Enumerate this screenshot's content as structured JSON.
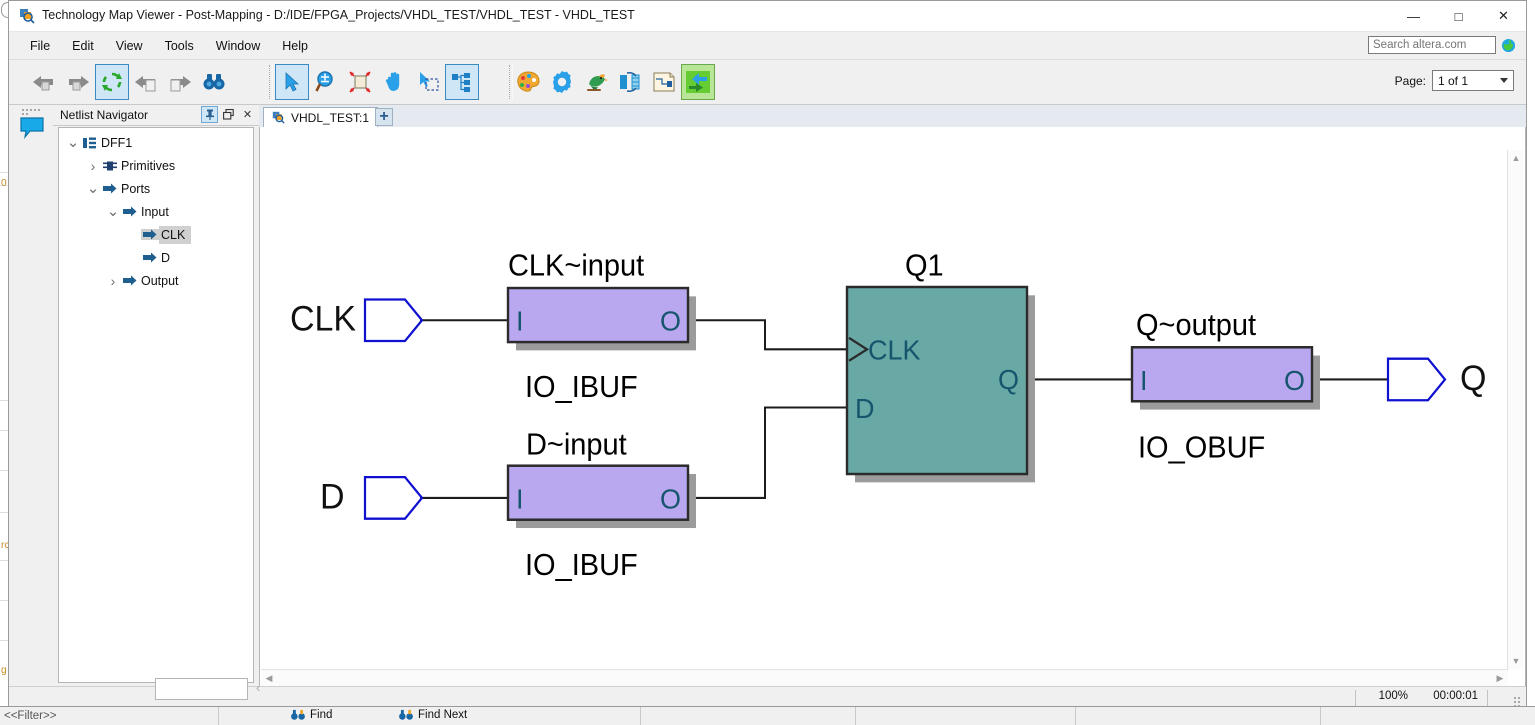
{
  "window": {
    "title": "Technology Map Viewer - Post-Mapping - D:/IDE/FPGA_Projects/VHDL_TEST/VHDL_TEST - VHDL_TEST",
    "app_icon": "technology-map-viewer-icon",
    "minimize": "—",
    "maximize": "□",
    "close": "✕"
  },
  "menu": {
    "items": [
      {
        "label": "File",
        "mnemonic": "F"
      },
      {
        "label": "Edit",
        "mnemonic": "E"
      },
      {
        "label": "View",
        "mnemonic": "V"
      },
      {
        "label": "Tools",
        "mnemonic": "T"
      },
      {
        "label": "Window",
        "mnemonic": "W"
      },
      {
        "label": "Help",
        "mnemonic": "H"
      }
    ],
    "search_placeholder": "Search altera.com",
    "search_value": "",
    "globe_icon": "globe-icon"
  },
  "toolbar": {
    "group1": [
      {
        "name": "back-icon",
        "enabled": false
      },
      {
        "name": "forward-icon",
        "enabled": false
      },
      {
        "name": "refresh-icon",
        "enabled": true,
        "active": true
      },
      {
        "name": "previous-page-icon",
        "enabled": false
      },
      {
        "name": "next-page-icon",
        "enabled": false
      },
      {
        "name": "find-binoculars-icon",
        "enabled": true
      }
    ],
    "group2": [
      {
        "name": "select-pointer-icon",
        "active": true
      },
      {
        "name": "zoom-tool-icon",
        "active": false
      },
      {
        "name": "fit-in-window-icon",
        "active": false
      },
      {
        "name": "hand-pan-icon",
        "active": false
      },
      {
        "name": "rubber-band-select-icon",
        "active": false
      },
      {
        "name": "hierarchy-tree-icon",
        "active": true
      }
    ],
    "group3": [
      {
        "name": "color-palette-icon",
        "active": false
      },
      {
        "name": "settings-gear-icon",
        "active": false
      },
      {
        "name": "bird-chip-planner-icon",
        "active": false
      },
      {
        "name": "rotate-object-icon",
        "active": false
      },
      {
        "name": "schematic-doc-icon",
        "active": false
      },
      {
        "name": "inputs-outputs-icon",
        "active": true
      }
    ],
    "page_label": "Page:",
    "page_value": "1 of 1"
  },
  "rail": {
    "bubble_icon": "message-bubble-icon"
  },
  "netlist_navigator": {
    "title": "Netlist Navigator",
    "buttons": {
      "pin": "⚓",
      "float": "❐",
      "close": "✕"
    },
    "tree": [
      {
        "label": "DFF1",
        "depth": 0,
        "chev": "v",
        "icon": "hierarchy-icon",
        "selected": false
      },
      {
        "label": "Primitives",
        "depth": 1,
        "chev": ">",
        "icon": "primitives-icon",
        "selected": false
      },
      {
        "label": "Ports",
        "depth": 1,
        "chev": "v",
        "icon": "port-icon",
        "selected": false
      },
      {
        "label": "Input",
        "depth": 2,
        "chev": "v",
        "icon": "port-icon",
        "selected": false
      },
      {
        "label": "CLK",
        "depth": 3,
        "chev": "",
        "icon": "port-icon",
        "selected": true
      },
      {
        "label": "D",
        "depth": 3,
        "chev": "",
        "icon": "port-icon",
        "selected": false
      },
      {
        "label": "Output",
        "depth": 2,
        "chev": ">",
        "icon": "port-icon",
        "selected": false
      }
    ]
  },
  "document": {
    "tab_label": "VHDL_TEST:1",
    "tab_icon": "technology-map-viewer-icon",
    "new_tab_label": "+"
  },
  "schematic": {
    "colors": {
      "buffer_fill": "#b9a8f0",
      "buffer_border": "#2b2b2b",
      "ff_fill": "#68a9a6",
      "ff_border": "#2b2b2b",
      "shadow": "#9b9b9b",
      "port_border": "#1010d0",
      "wire": "#1c1c1c",
      "pin_text": "#17556e",
      "label_text": "#000000"
    },
    "ports": [
      {
        "name": "CLK",
        "label": "CLK",
        "direction": "input"
      },
      {
        "name": "D",
        "label": "D",
        "direction": "input"
      },
      {
        "name": "Q",
        "label": "Q",
        "direction": "output"
      }
    ],
    "blocks": [
      {
        "id": "clk-input-buffer",
        "title": "CLK~input",
        "subtitle": "IO_IBUF",
        "type": "buffer",
        "pins_left": [
          "I"
        ],
        "pins_right": [
          "O"
        ]
      },
      {
        "id": "d-input-buffer",
        "title": "D~input",
        "subtitle": "IO_IBUF",
        "type": "buffer",
        "pins_left": [
          "I"
        ],
        "pins_right": [
          "O"
        ]
      },
      {
        "id": "q1-flipflop",
        "title": "Q1",
        "subtitle": "",
        "type": "flipflop",
        "pins_left": [
          "CLK",
          "D"
        ],
        "pins_right": [
          "Q"
        ]
      },
      {
        "id": "q-output-buffer",
        "title": "Q~output",
        "subtitle": "IO_OBUF",
        "type": "buffer",
        "pins_left": [
          "I"
        ],
        "pins_right": [
          "O"
        ]
      }
    ]
  },
  "statusbar": {
    "zoom": "100%",
    "time": "00:00:01"
  },
  "bottom_window": {
    "filter_placeholder": "<<Filter>>",
    "find_label": "Find",
    "find_next_label": "Find Next"
  }
}
